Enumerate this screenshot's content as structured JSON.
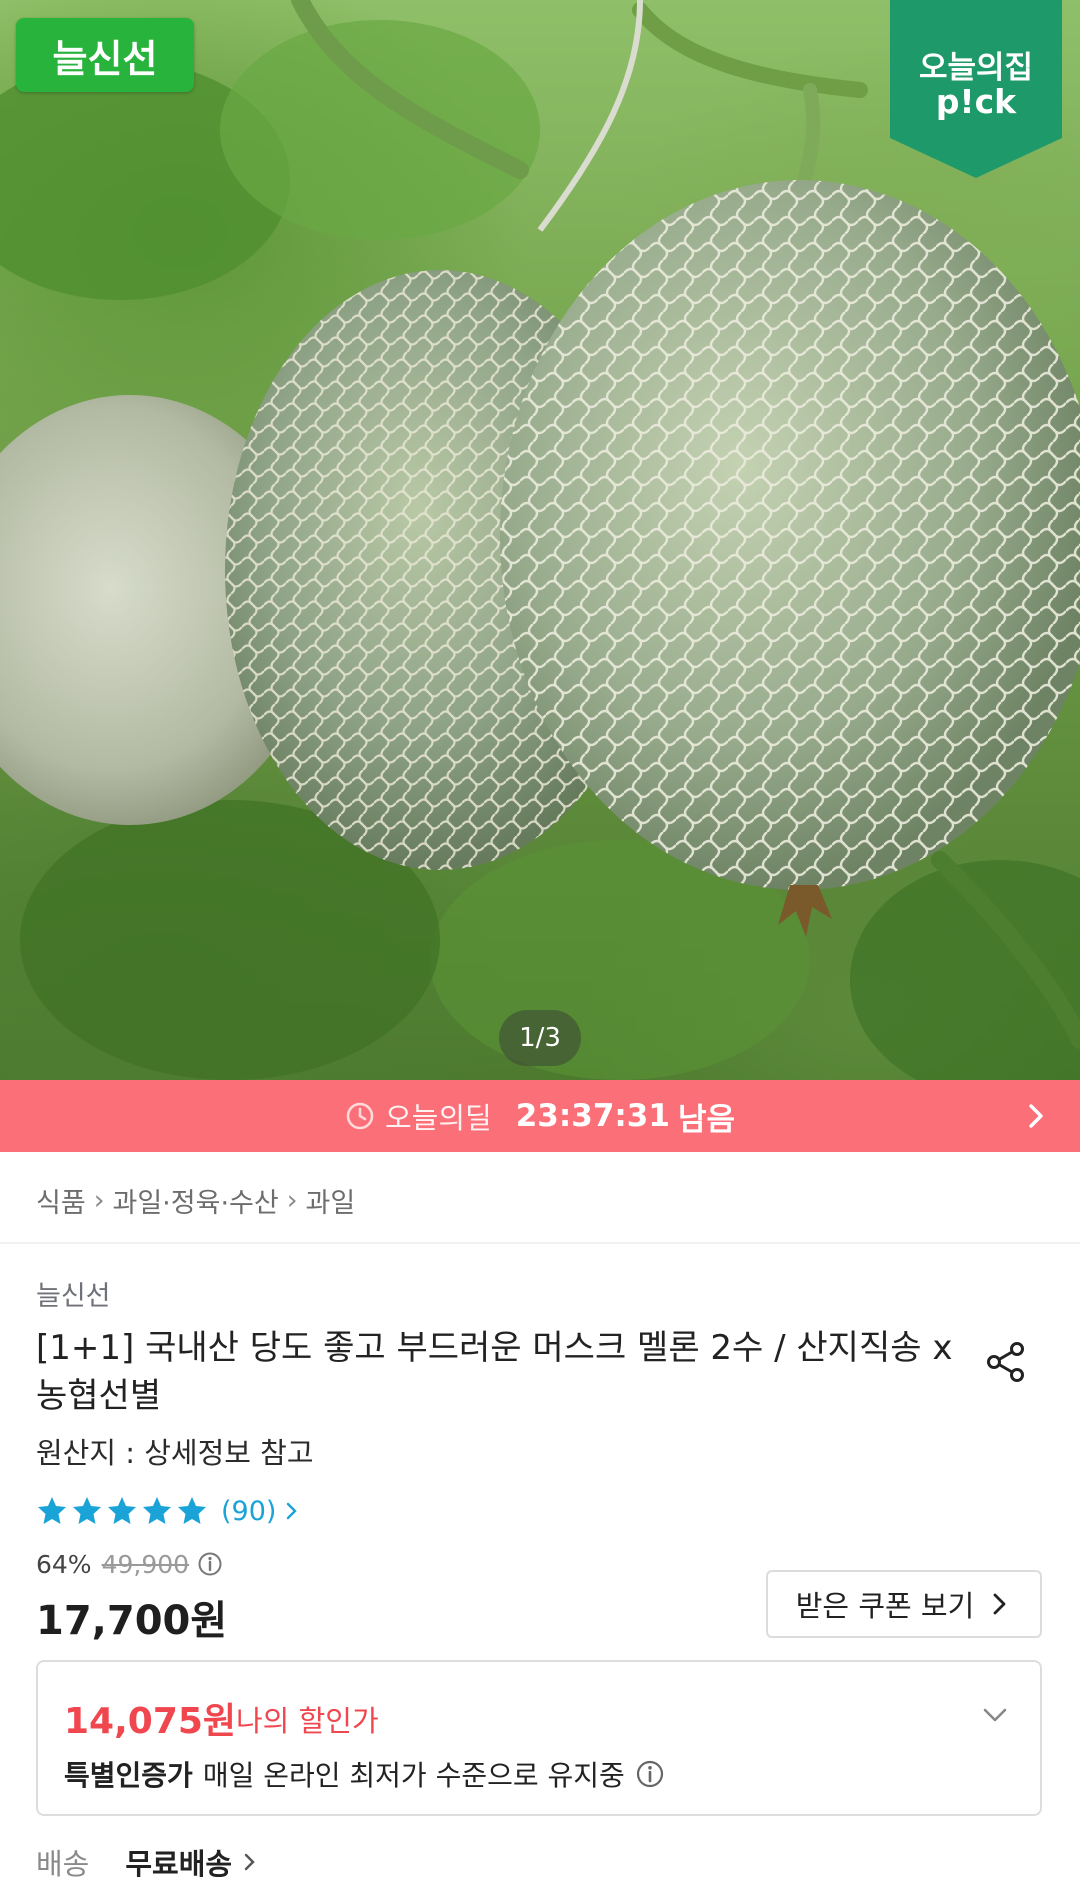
{
  "hero": {
    "brand_tag": "늘신선",
    "pick_badge_line1": "오늘의집",
    "pick_badge_line2": "p!ck",
    "page_indicator": "1/3"
  },
  "deal": {
    "label": "오늘의딜",
    "time_left": "23:37:31",
    "suffix": "남음"
  },
  "breadcrumb": [
    "식품",
    "과일·정육·수산",
    "과일"
  ],
  "product": {
    "brand": "늘신선",
    "title": "[1+1] 국내산 당도 좋고 부드러운 머스크 멜론 2수 / 산지직송 x 농협선별",
    "origin": "원산지 : 상세정보 참고",
    "rating_stars": 5,
    "review_count": "(90)",
    "discount_rate": "64%",
    "original_price": "49,900",
    "price": "17,700원",
    "coupon_button": "받은 쿠폰 보기"
  },
  "my_price": {
    "amount": "14,075원",
    "label": "나의 할인가",
    "cert_label": "특별인증가",
    "cert_desc": "매일 온라인 최저가 수준으로 유지중"
  },
  "shipping": {
    "label": "배송",
    "value": "무료배송"
  },
  "colors": {
    "deal_bar": "#fb6f78",
    "brand_green": "#28b43c",
    "pick_teal": "#1e9a6a",
    "discount_red": "#f0474f",
    "star_blue": "#1aa3d6"
  }
}
